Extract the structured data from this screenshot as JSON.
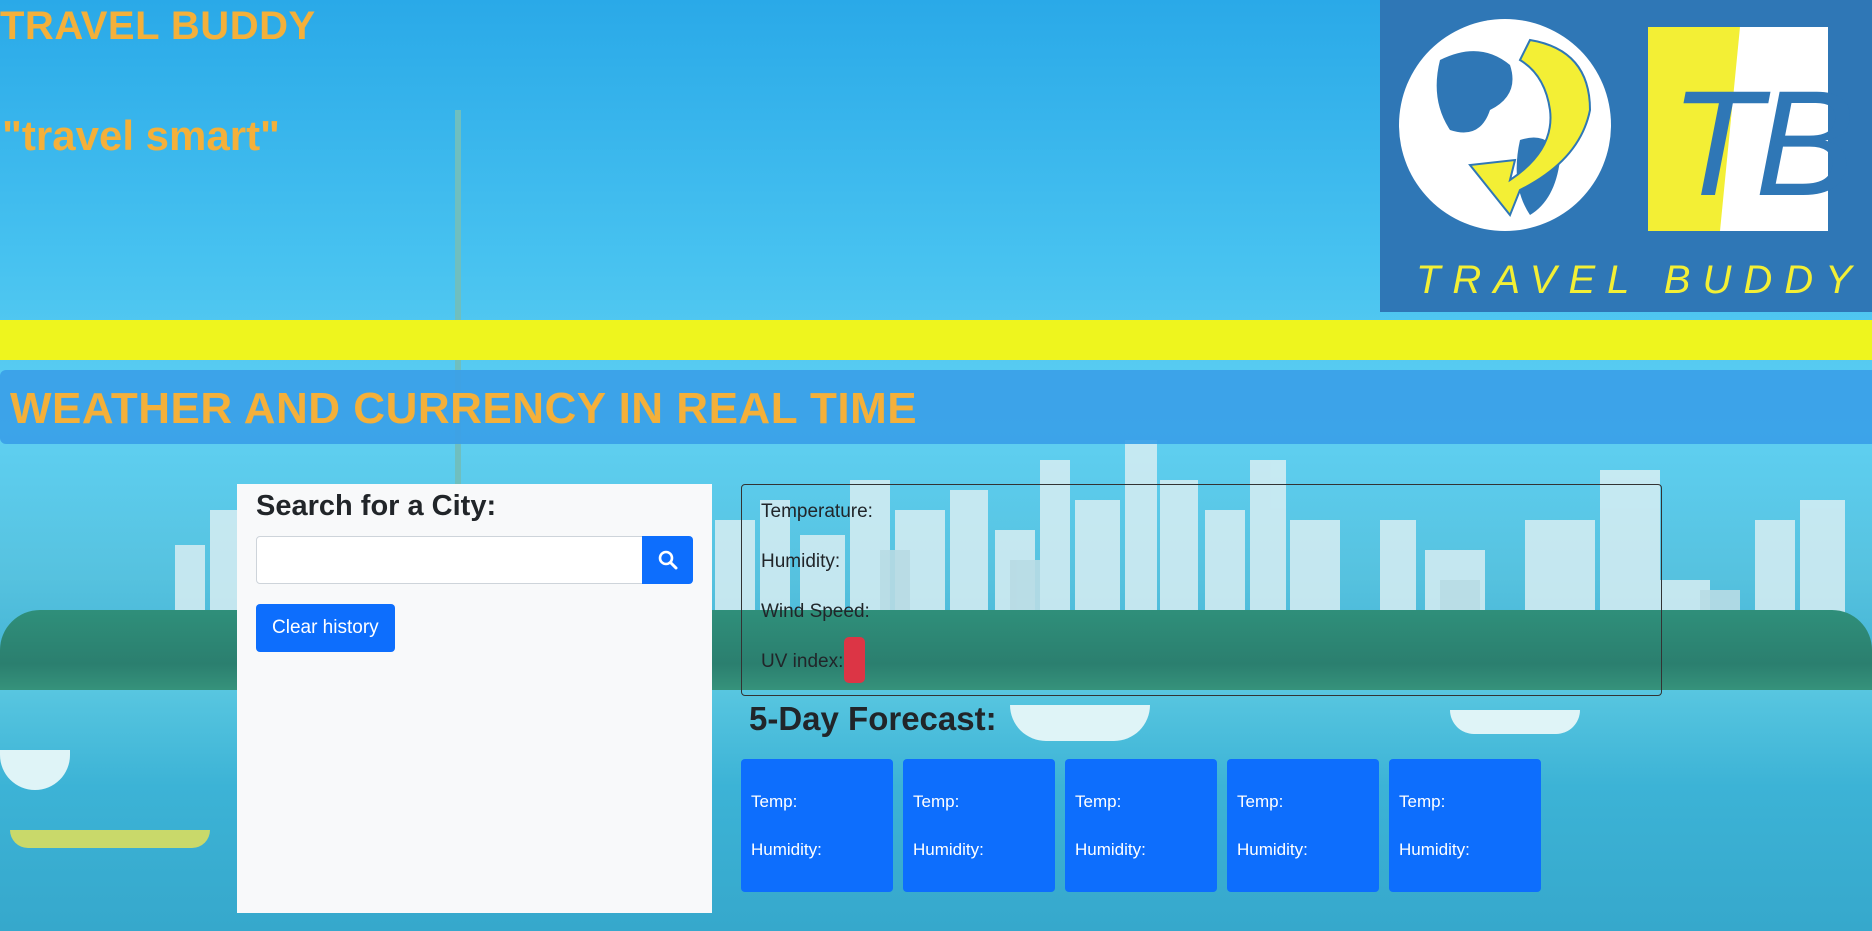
{
  "header": {
    "title": "TRAVEL BUDDY",
    "slogan": "\"travel smart\"",
    "logo": {
      "monogram": "TB",
      "text": "TRAVEL BUDDY",
      "icon": "globe-arrow-icon"
    }
  },
  "banner": {
    "text": "WEATHER AND CURRENCY IN REAL TIME"
  },
  "search": {
    "heading": "Search for a City:",
    "input_value": "",
    "placeholder": "",
    "search_icon": "search-icon",
    "clear_label": "Clear history"
  },
  "current_weather": {
    "temperature_label": "Temperature:",
    "humidity_label": "Humidity:",
    "wind_label": "Wind Speed:",
    "uv_label": "UV index:",
    "uv_badge_color": "#dc3545"
  },
  "forecast": {
    "heading": "5-Day Forecast:",
    "cards": [
      {
        "temp_label": "Temp:",
        "humidity_label": "Humidity:"
      },
      {
        "temp_label": "Temp:",
        "humidity_label": "Humidity:"
      },
      {
        "temp_label": "Temp:",
        "humidity_label": "Humidity:"
      },
      {
        "temp_label": "Temp:",
        "humidity_label": "Humidity:"
      },
      {
        "temp_label": "Temp:",
        "humidity_label": "Humidity:"
      }
    ]
  },
  "colors": {
    "brand_orange": "#f4b03a",
    "brand_yellow": "#eef51e",
    "primary_blue": "#0d6efd",
    "logo_blue": "#2f77b6"
  }
}
